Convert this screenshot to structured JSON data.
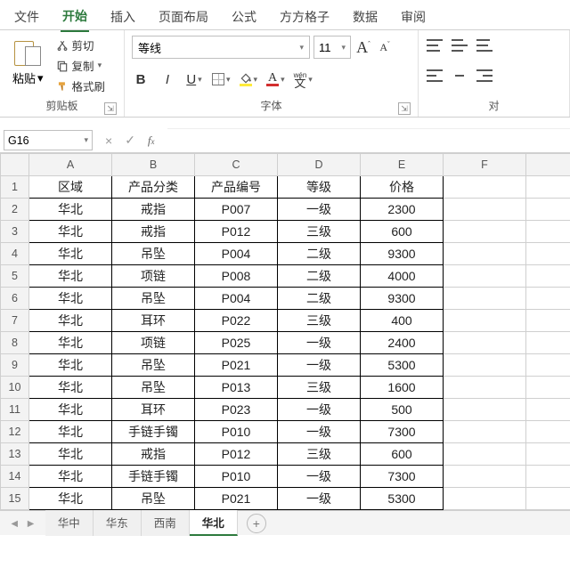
{
  "tabs": {
    "file": "文件",
    "home": "开始",
    "insert": "插入",
    "layout": "页面布局",
    "formula": "公式",
    "fangge": "方方格子",
    "data": "数据",
    "review": "审阅"
  },
  "active_tab": "home",
  "clipboard": {
    "paste": "粘贴",
    "cut": "剪切",
    "copy": "复制",
    "format_painter": "格式刷",
    "group_label": "剪贴板"
  },
  "font": {
    "name": "等线",
    "size": "11",
    "bold": "B",
    "italic": "I",
    "underline": "U",
    "wen": "wén",
    "wen_han": "文",
    "group_label": "字体"
  },
  "align": {
    "group_label": "对"
  },
  "name_box": "G16",
  "formula_value": "",
  "columns": [
    "A",
    "B",
    "C",
    "D",
    "E",
    "F"
  ],
  "headers": [
    "区域",
    "产品分类",
    "产品编号",
    "等级",
    "价格"
  ],
  "rows": [
    [
      "华北",
      "戒指",
      "P007",
      "一级",
      "2300"
    ],
    [
      "华北",
      "戒指",
      "P012",
      "三级",
      "600"
    ],
    [
      "华北",
      "吊坠",
      "P004",
      "二级",
      "9300"
    ],
    [
      "华北",
      "项链",
      "P008",
      "二级",
      "4000"
    ],
    [
      "华北",
      "吊坠",
      "P004",
      "二级",
      "9300"
    ],
    [
      "华北",
      "耳环",
      "P022",
      "三级",
      "400"
    ],
    [
      "华北",
      "项链",
      "P025",
      "一级",
      "2400"
    ],
    [
      "华北",
      "吊坠",
      "P021",
      "一级",
      "5300"
    ],
    [
      "华北",
      "吊坠",
      "P013",
      "三级",
      "1600"
    ],
    [
      "华北",
      "耳环",
      "P023",
      "一级",
      "500"
    ],
    [
      "华北",
      "手链手镯",
      "P010",
      "一级",
      "7300"
    ],
    [
      "华北",
      "戒指",
      "P012",
      "三级",
      "600"
    ],
    [
      "华北",
      "手链手镯",
      "P010",
      "一级",
      "7300"
    ],
    [
      "华北",
      "吊坠",
      "P021",
      "一级",
      "5300"
    ]
  ],
  "sheet_tabs": [
    "华中",
    "华东",
    "西南",
    "华北"
  ],
  "active_sheet": "华北",
  "colors": {
    "accent": "#2d7a3d",
    "highlight": "#ffeb3b",
    "font_color": "#d32f2f"
  }
}
